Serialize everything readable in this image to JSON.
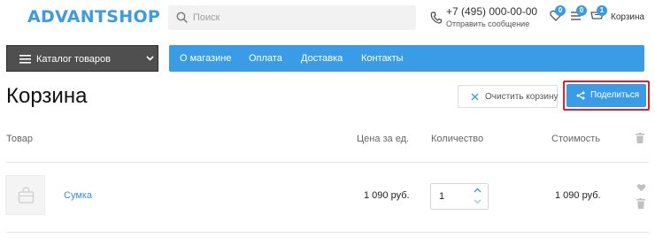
{
  "header": {
    "logo_text": "ADVANTSHOP",
    "search_placeholder": "Поиск",
    "phone": "+7 (495) 000-00-00",
    "send_message": "Отправить сообщение",
    "wishlist_count": "0",
    "compare_count": "0",
    "cart_count": "1",
    "cart_label": "Корзина",
    "icons": [
      "search-icon",
      "phone-icon",
      "heart-icon",
      "compare-icon",
      "cart-icon"
    ]
  },
  "nav": {
    "catalog_label": "Каталог товаров",
    "menu_items": [
      {
        "label": "О магазине"
      },
      {
        "label": "Оплата"
      },
      {
        "label": "Доставка"
      },
      {
        "label": "Контакты"
      }
    ]
  },
  "cart": {
    "title": "Корзина",
    "clear_label": "Очистить корзину",
    "share_label": "Поделиться",
    "columns": {
      "product": "Товар",
      "unit_price": "Цена за ед.",
      "quantity": "Количество",
      "cost": "Стоимость"
    },
    "items": [
      {
        "name": "Сумка",
        "unit_price": "1 090 руб.",
        "quantity": "1",
        "cost": "1 090 руб."
      }
    ]
  },
  "colors": {
    "accent": "#3a9be6",
    "dark_button": "#4f4f4f",
    "highlight_outline": "#e0202b"
  }
}
